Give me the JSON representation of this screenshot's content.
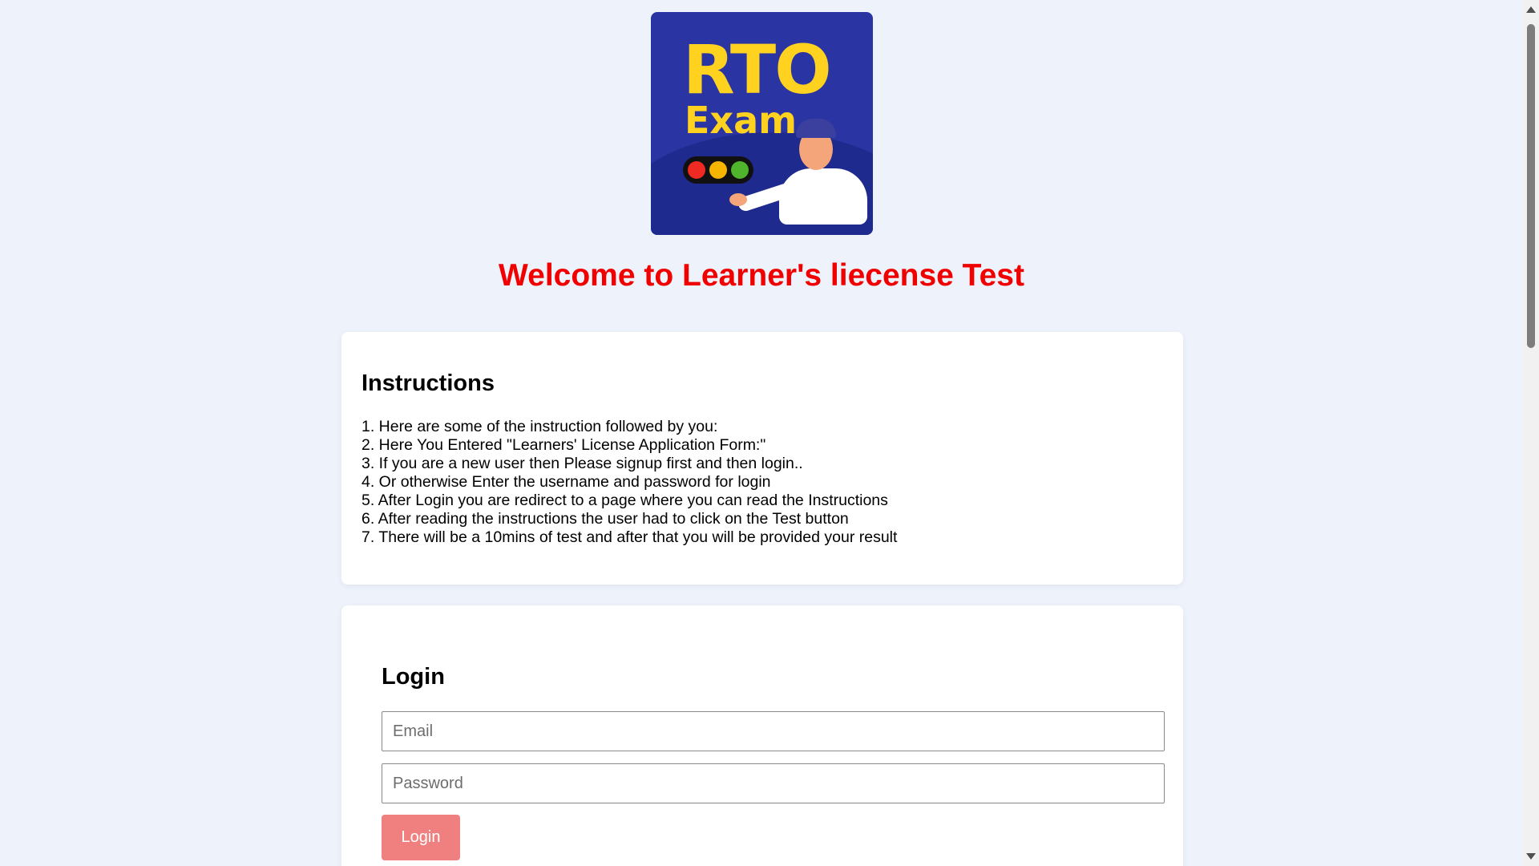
{
  "logo": {
    "line1": "RTO",
    "line2": "Exam"
  },
  "welcome_title": "Welcome to Learner's liecense Test",
  "instructions": {
    "heading": "Instructions",
    "items": [
      "1. Here are some of the instruction followed by you:",
      "2. Here You Entered \"Learners' License Application Form:\"",
      "3. If you are a new user then Please signup first and then login..",
      "4. Or otherwise Enter the username and password for login",
      "5. After Login you are redirect to a page where you can read the Instructions",
      "6. After reading the instructions the user had to click on the Test button",
      "7. There will be a 10mins of test and after that you will be provided your result"
    ]
  },
  "login": {
    "heading": "Login",
    "email_placeholder": "Email",
    "password_placeholder": "Password",
    "button_label": "Login"
  },
  "colors": {
    "page_background": "#eef2fb",
    "welcome_text": "#f10000",
    "login_button": "#f08080",
    "logo_background": "#2a35a3",
    "logo_text": "#ffd21f"
  },
  "icons": {
    "logo": "rto-exam-logo-icon",
    "traffic_light": "traffic-light-icon",
    "officer": "traffic-officer-icon"
  }
}
